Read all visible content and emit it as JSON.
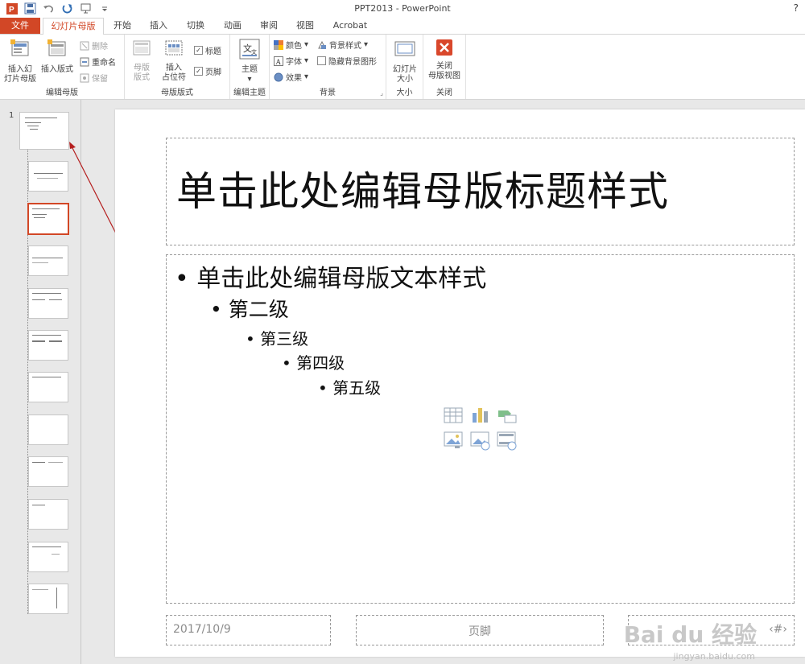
{
  "window": {
    "title": "PPT2013 - PowerPoint",
    "help": "?"
  },
  "tabs": [
    {
      "label": "文件"
    },
    {
      "label": "幻灯片母版"
    },
    {
      "label": "开始"
    },
    {
      "label": "插入"
    },
    {
      "label": "切换"
    },
    {
      "label": "动画"
    },
    {
      "label": "审阅"
    },
    {
      "label": "视图"
    },
    {
      "label": "Acrobat"
    }
  ],
  "ribbon": {
    "edit_master": {
      "label": "编辑母版",
      "insert_slide_master_line1": "插入幻",
      "insert_slide_master_line2": "灯片母版",
      "insert_layout": "插入版式",
      "delete": "删除",
      "rename": "重命名",
      "preserve": "保留"
    },
    "master_layout": {
      "label": "母版版式",
      "master_layout_line1": "母版",
      "master_layout_line2": "版式",
      "insert_placeholder_line1": "插入",
      "insert_placeholder_line2": "占位符",
      "title_check": "标题",
      "footer_check": "页脚"
    },
    "edit_theme": {
      "label": "编辑主题",
      "theme": "主题"
    },
    "background": {
      "label": "背景",
      "colors": "颜色",
      "fonts": "字体",
      "effects": "效果",
      "bg_styles": "背景样式",
      "hide_bg": "隐藏背景图形"
    },
    "size": {
      "label": "大小",
      "slide_size_line1": "幻灯片",
      "slide_size_line2": "大小"
    },
    "close": {
      "label": "关闭",
      "close_line1": "关闭",
      "close_line2": "母版视图"
    }
  },
  "thumbnails": {
    "number": "1"
  },
  "slide": {
    "title": "单击此处编辑母版标题样式",
    "levels": [
      "单击此处编辑母版文本样式",
      "第二级",
      "第三级",
      "第四级",
      "第五级"
    ],
    "footer_date": "2017/10/9",
    "footer_text": "页脚",
    "footer_num": "‹#›"
  },
  "watermark": {
    "main": "Bai du 经验",
    "sub": "jingyan.baidu.com"
  },
  "colors": {
    "accent": "#d24726",
    "title_text": "#111111",
    "placeholder_border": "#9a9a9a"
  }
}
